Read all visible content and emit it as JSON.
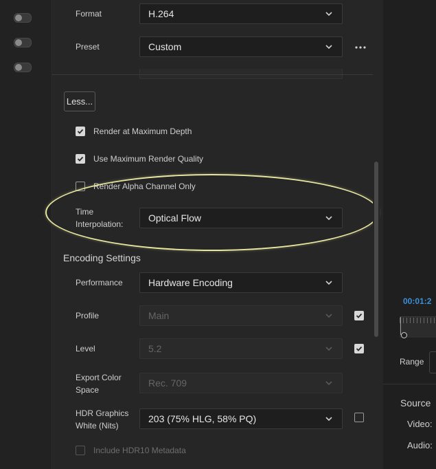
{
  "encoding": {
    "format": {
      "label": "Format",
      "value": "H.264"
    },
    "preset": {
      "label": "Preset",
      "value": "Custom"
    },
    "less_button": "Less...",
    "render_max_depth": {
      "label": "Render at Maximum Depth",
      "checked": true
    },
    "max_render_quality": {
      "label": "Use Maximum Render Quality",
      "checked": true
    },
    "alpha_only": {
      "label": "Render Alpha Channel Only",
      "checked": false
    },
    "time_interpolation": {
      "label_line1": "Time",
      "label_line2": "Interpolation:",
      "value": "Optical Flow"
    }
  },
  "encoding_settings": {
    "title": "Encoding Settings",
    "performance": {
      "label": "Performance",
      "value": "Hardware Encoding"
    },
    "profile": {
      "label": "Profile",
      "value": "Main",
      "auto_checked": true
    },
    "level": {
      "label": "Level",
      "value": "5.2",
      "auto_checked": true
    },
    "export_color_space": {
      "label_line1": "Export Color",
      "label_line2": "Space",
      "value": "Rec. 709"
    },
    "hdr_graphics_white": {
      "label_line1": "HDR Graphics",
      "label_line2": "White (Nits)",
      "value": "203 (75% HLG, 58% PQ)",
      "checked": false
    },
    "include_hdr10": {
      "label": "Include HDR10 Metadata",
      "checked": false
    }
  },
  "right_panel": {
    "timecode": "00:01:2",
    "range_label": "Range",
    "source_label": "Source",
    "video_label": "Video:",
    "audio_label": "Audio:"
  },
  "colors": {
    "accent_timecode": "#3d8fd6",
    "annotation": "#e8e6a0"
  }
}
